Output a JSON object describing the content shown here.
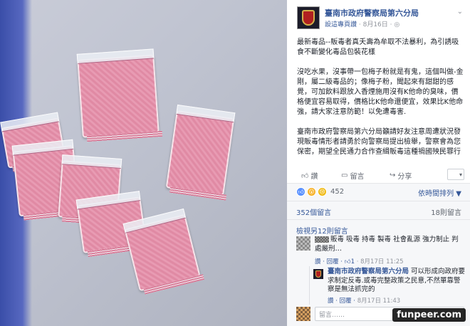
{
  "page": {
    "name": "臺南市政府警察局第六分局",
    "subline_author": "設這專頁讚",
    "subline_date": " · 8月16日 · ",
    "globe_icon": "globe-icon",
    "menu_icon": "chevron-down-icon"
  },
  "post": {
    "paragraph1": "最新毒品--販毒者真夭壽為牟取不法暴利，為引誘吸食不斷變化毒品包裝花樣",
    "paragraph2": "沒吃水果，沒事帶一包梅子粉就是有鬼，這個叫做-金剛，屬二級毒品的；像梅子粉，聞起來有甜甜的感覺，可加飲料跟放入香煙施用沒有K他命的臭味，價格便宜容易取得，價格比K他命還便宜，效果比K他命強，請大家注意防範！以免遭毒害.",
    "paragraph3": "臺南市政府警察局第六分局籲請好友注意周遭狀況發現販毒情形者請勇於向警察局提出檢舉，警察會為您保密，期望全民通力合作查緝販毒這種禍國殃民罪行"
  },
  "actions": {
    "like": "讚",
    "comment": "留言",
    "share": "分享",
    "page_selector_icon": "caret-down-icon"
  },
  "reactions": {
    "count": "452",
    "sort_label": "依時間排列 ▼"
  },
  "stats": {
    "comments": "352個留言",
    "shares": "18則留言"
  },
  "comments": {
    "view_more": "檢視另12則留言",
    "first": {
      "text": "販毒 吸毒 持毒 製毒 社會亂源 強力制止 判處嚴刑…",
      "reply_link": "讚 · 回覆 · ",
      "like_count": "1",
      "time": " · 8月17日 11:25"
    },
    "reply": {
      "author": "臺南市政府警察局第六分局",
      "text": " 可以形成向政府要求制定反毒.或毒完整政策之民意,不然單靠警察是無法抓完的",
      "meta_link": "讚 · 回覆 · ",
      "time": "8月17日 11:43"
    },
    "compose_placeholder": "留言……"
  },
  "watermark": "funpeer.com"
}
